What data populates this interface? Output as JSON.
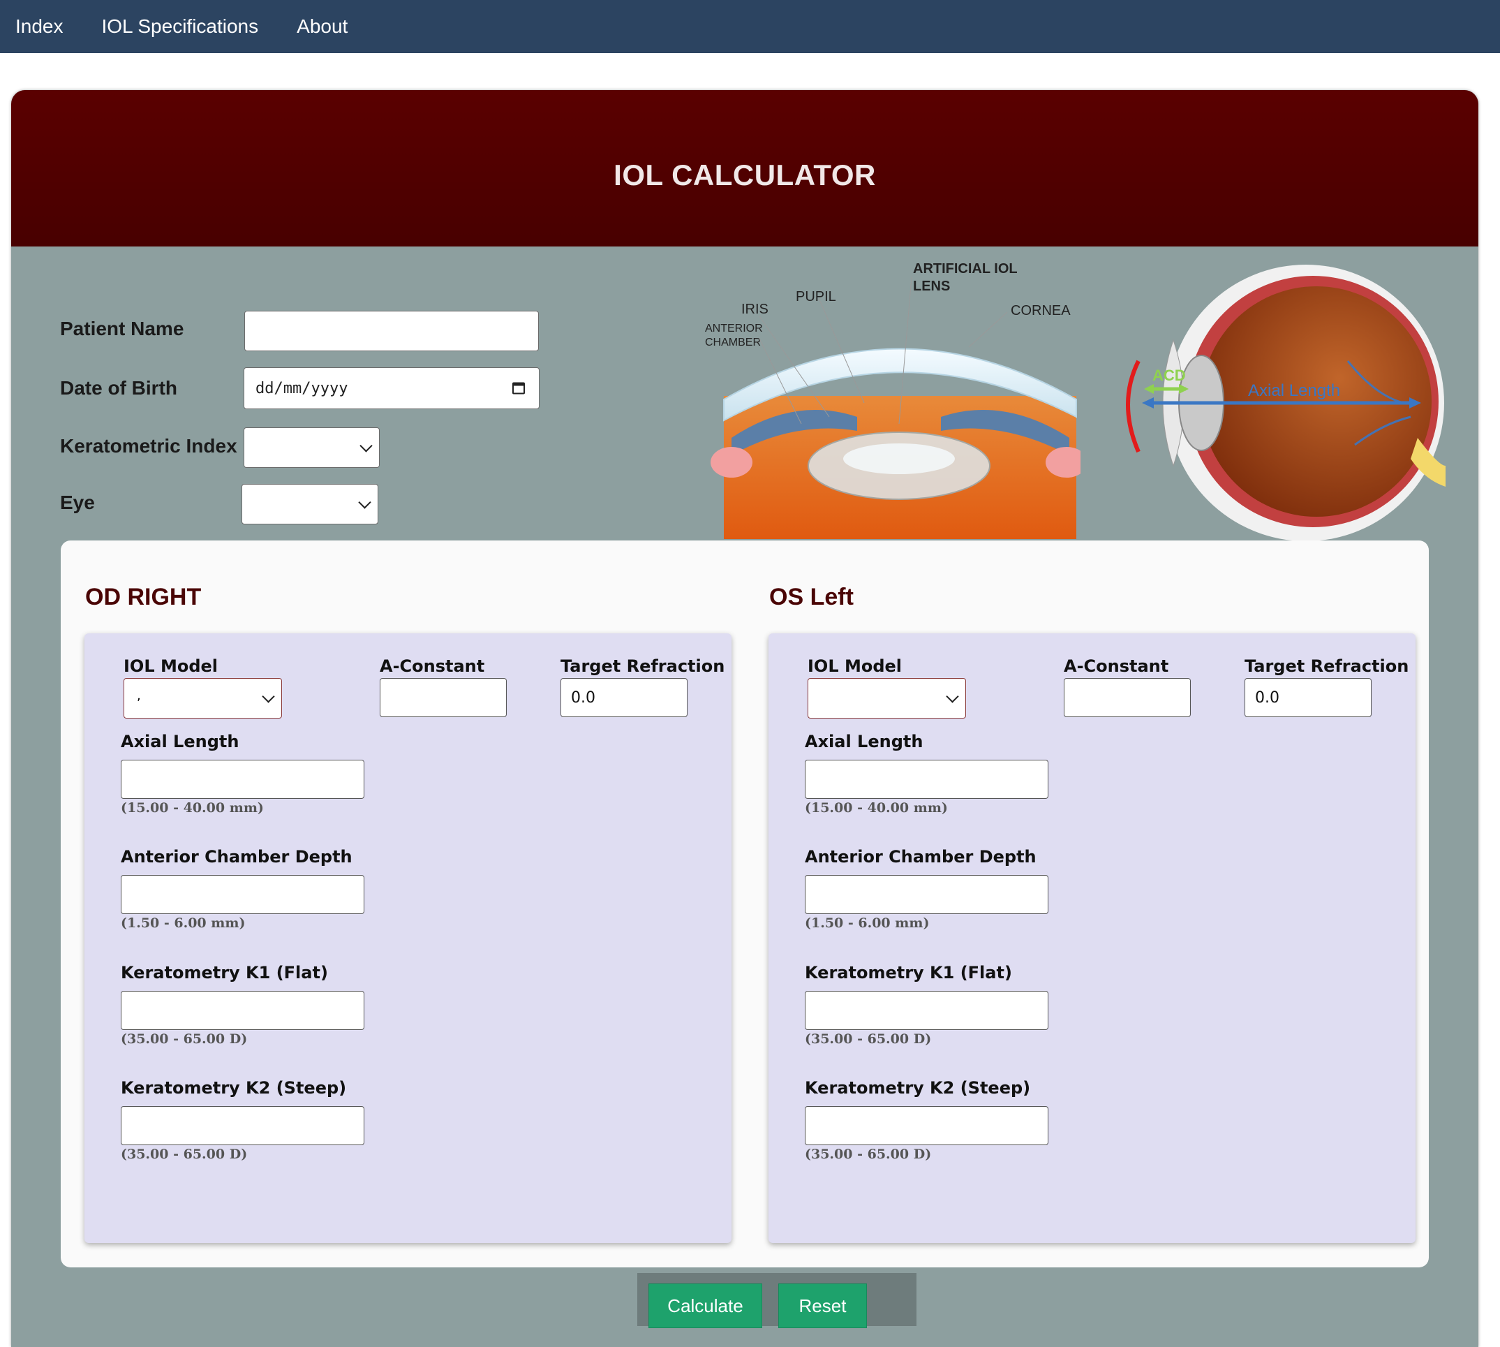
{
  "nav": {
    "items": [
      "Index",
      "IOL Specifications",
      "About"
    ]
  },
  "header": {
    "title": "IOL CALCULATOR"
  },
  "patient": {
    "name_label": "Patient Name",
    "name_value": "",
    "dob_label": "Date of Birth",
    "dob_placeholder": "dd/mm/yyyy",
    "keratometric_label": "Keratometric Index",
    "keratometric_value": "",
    "eye_label": "Eye",
    "eye_value": ""
  },
  "diagram1": {
    "labels": {
      "artificial": "ARTIFICIAL IOL",
      "lens": "LENS",
      "pupil": "PUPIL",
      "iris": "IRIS",
      "anterior": "ANTERIOR",
      "chamber": "CHAMBER",
      "cornea": "CORNEA"
    }
  },
  "diagram2": {
    "labels": {
      "acd": "ACD",
      "axial": "Axial Length"
    }
  },
  "od": {
    "title": "OD RIGHT",
    "iol_model_label": "IOL Model",
    "iol_model_value": ",",
    "a_constant_label": "A-Constant",
    "a_constant_value": "",
    "target_label": "Target Refraction",
    "target_value": "0.0",
    "axial_label": "Axial Length",
    "axial_hint": "(15.00 - 40.00 mm)",
    "acd_label": "Anterior Chamber Depth",
    "acd_hint": "(1.50 - 6.00 mm)",
    "k1_label": "Keratometry K1 (Flat)",
    "k1_hint": "(35.00 - 65.00 D)",
    "k2_label": "Keratometry K2 (Steep)",
    "k2_hint": "(35.00 - 65.00 D)"
  },
  "os": {
    "title": "OS Left",
    "iol_model_label": "IOL Model",
    "iol_model_value": "",
    "a_constant_label": "A-Constant",
    "a_constant_value": "",
    "target_label": "Target Refraction",
    "target_value": "0.0",
    "axial_label": "Axial Length",
    "axial_hint": "(15.00 - 40.00 mm)",
    "acd_label": "Anterior Chamber Depth",
    "acd_hint": "(1.50 - 6.00 mm)",
    "k1_label": "Keratometry K1 (Flat)",
    "k1_hint": "(35.00 - 65.00 D)",
    "k2_label": "Keratometry K2 (Steep)",
    "k2_hint": "(35.00 - 65.00 D)"
  },
  "buttons": {
    "calculate": "Calculate",
    "reset": "Reset"
  },
  "colors": {
    "navbar": "#2c4461",
    "header": "#500000",
    "panel_bg": "#8d9f9f",
    "eye_box": "#dfddf2",
    "button": "#1ea26c"
  }
}
